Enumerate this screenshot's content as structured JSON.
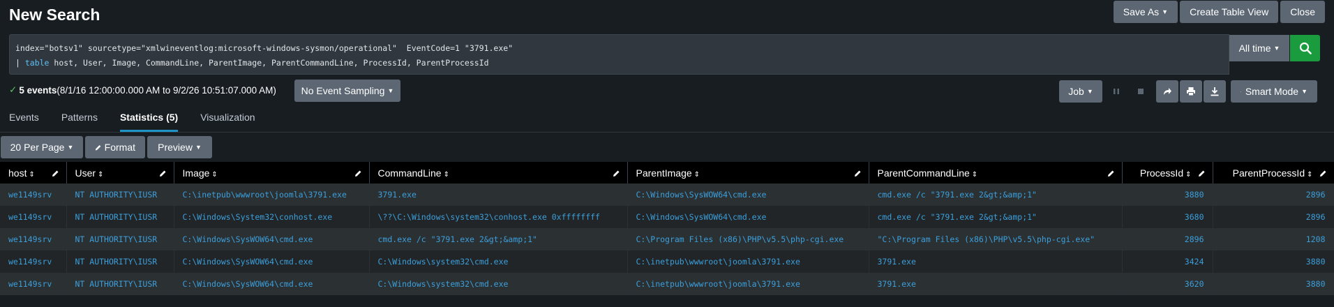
{
  "header": {
    "title": "New Search",
    "save_as": "Save As",
    "create_table_view": "Create Table View",
    "close": "Close"
  },
  "search": {
    "line1": "index=\"botsv1\" sourcetype=\"xmlwineventlog:microsoft-windows-sysmon/operational\"  EventCode=1 \"3791.exe\"",
    "line2_pipe": "| ",
    "line2_cmd": "table",
    "line2_rest": " host, User, Image, CommandLine, ParentImage, ParentCommandLine, ProcessId, ParentProcessId",
    "time_range": "All time"
  },
  "status": {
    "count": "5 events",
    "range": " (8/1/16 12:00:00.000 AM to 9/2/26 10:51:07.000 AM)",
    "sampling": "No Event Sampling",
    "job": "Job",
    "mode": "Smart Mode"
  },
  "tabs": [
    "Events",
    "Patterns",
    "Statistics (5)",
    "Visualization"
  ],
  "active_tab": "Statistics (5)",
  "table_controls": {
    "per_page": "20 Per Page",
    "format": "Format",
    "preview": "Preview"
  },
  "table": {
    "columns": [
      "host",
      "User",
      "Image",
      "CommandLine",
      "ParentImage",
      "ParentCommandLine",
      "ProcessId",
      "ParentProcessId"
    ],
    "rows": [
      [
        "we1149srv",
        "NT AUTHORITY\\IUSR",
        "C:\\inetpub\\wwwroot\\joomla\\3791.exe",
        "3791.exe",
        "C:\\Windows\\SysWOW64\\cmd.exe",
        "cmd.exe /c \"3791.exe 2&gt;&amp;1\"",
        "3880",
        "2896"
      ],
      [
        "we1149srv",
        "NT AUTHORITY\\IUSR",
        "C:\\Windows\\System32\\conhost.exe",
        "\\??\\C:\\Windows\\system32\\conhost.exe 0xffffffff",
        "C:\\Windows\\SysWOW64\\cmd.exe",
        "cmd.exe /c \"3791.exe 2&gt;&amp;1\"",
        "3680",
        "2896"
      ],
      [
        "we1149srv",
        "NT AUTHORITY\\IUSR",
        "C:\\Windows\\SysWOW64\\cmd.exe",
        "cmd.exe /c \"3791.exe 2&gt;&amp;1\"",
        "C:\\Program Files (x86)\\PHP\\v5.5\\php-cgi.exe",
        "\"C:\\Program Files (x86)\\PHP\\v5.5\\php-cgi.exe\"",
        "2896",
        "1208"
      ],
      [
        "we1149srv",
        "NT AUTHORITY\\IUSR",
        "C:\\Windows\\SysWOW64\\cmd.exe",
        "C:\\Windows\\system32\\cmd.exe",
        "C:\\inetpub\\wwwroot\\joomla\\3791.exe",
        "3791.exe",
        "3424",
        "3880"
      ],
      [
        "we1149srv",
        "NT AUTHORITY\\IUSR",
        "C:\\Windows\\SysWOW64\\cmd.exe",
        "C:\\Windows\\system32\\cmd.exe",
        "C:\\inetpub\\wwwroot\\joomla\\3791.exe",
        "3791.exe",
        "3620",
        "3880"
      ]
    ]
  },
  "colors": {
    "accent": "#1e93c6",
    "search_go": "#1a9c3e",
    "link": "#3c9fdb"
  }
}
